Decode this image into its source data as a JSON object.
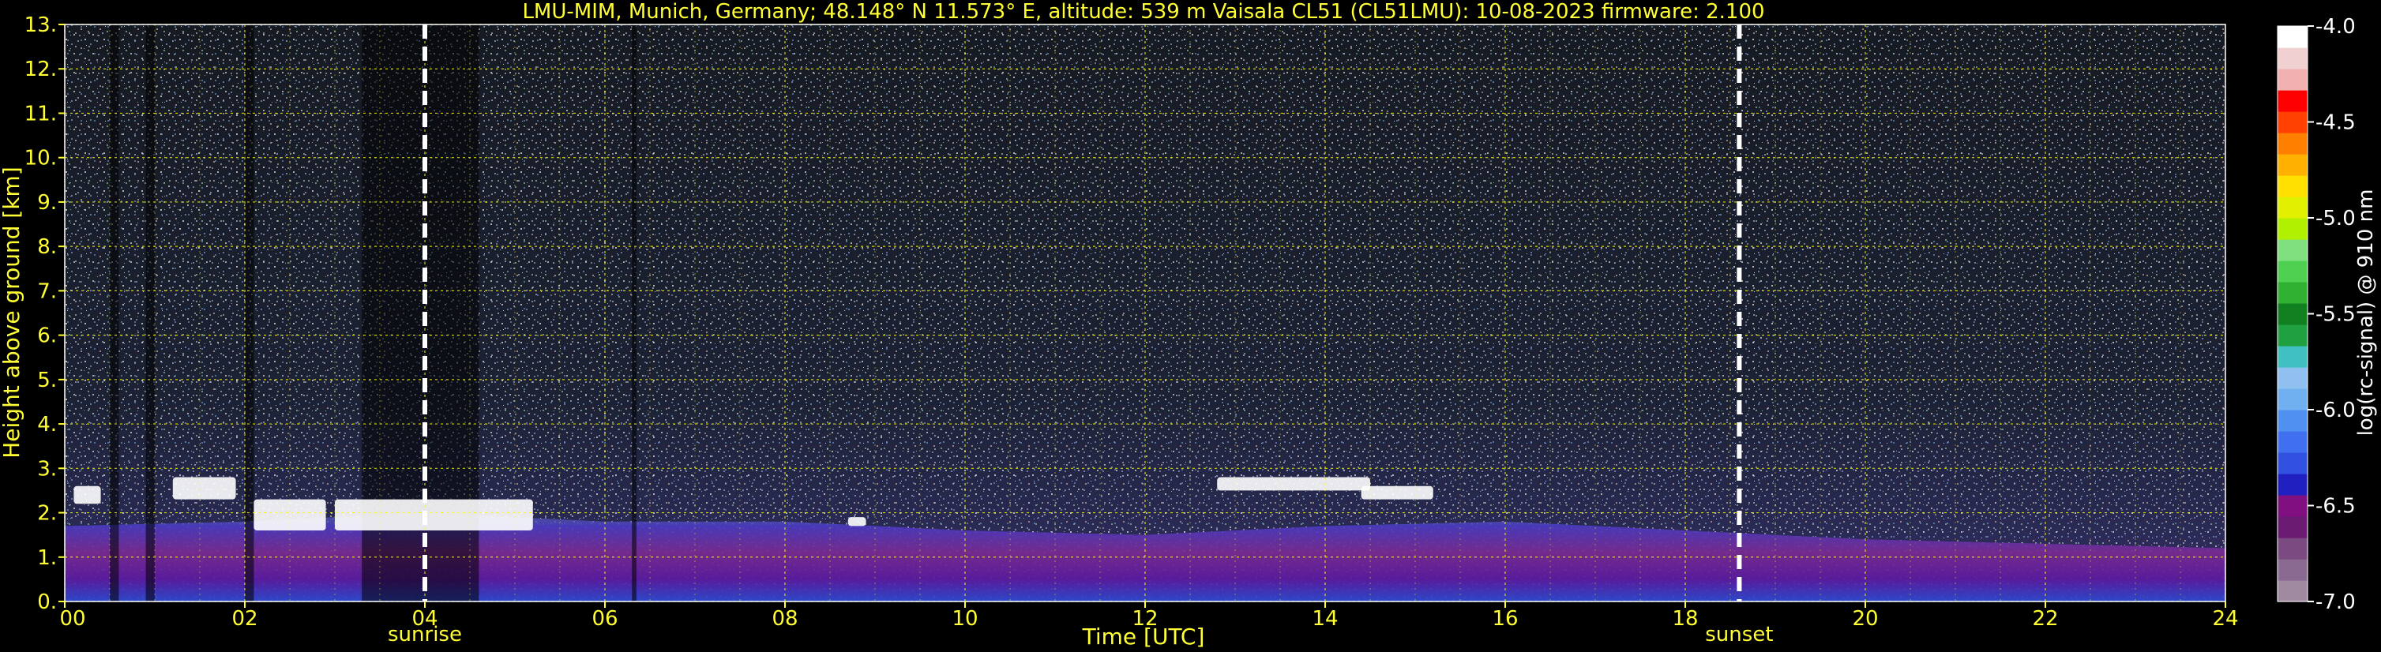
{
  "chart_data": {
    "type": "heatmap",
    "title": "LMU-MIM, Munich, Germany; 48.148° N 11.573° E, altitude: 539 m    Vaisala CL51 (CL51LMU): 10-08-2023    firmware: 2.100",
    "xlabel": "Time [UTC]",
    "ylabel": "Height above ground [km]",
    "xlim": [
      0,
      24
    ],
    "ylim": [
      0,
      13
    ],
    "x_ticks": [
      "00",
      "02",
      "04",
      "06",
      "08",
      "10",
      "12",
      "14",
      "16",
      "18",
      "20",
      "22",
      "24"
    ],
    "y_ticks": [
      "0.",
      "1.",
      "2.",
      "3.",
      "4.",
      "5.",
      "6.",
      "7.",
      "8.",
      "9.",
      "10.",
      "11.",
      "12.",
      "13."
    ],
    "grid": true,
    "grid_color": "#ffff00",
    "sunrise": {
      "time": 4.0,
      "label": "sunrise"
    },
    "sunset": {
      "time": 18.6,
      "label": "sunset"
    },
    "colorbar": {
      "label": "log(rc-signal) @ 910 nm",
      "range": [
        -7.0,
        -4.0
      ],
      "ticks": [
        "-4.0",
        "-4.5",
        "-5.0",
        "-5.5",
        "-6.0",
        "-6.5",
        "-7.0"
      ],
      "colors": [
        "#a08aa0",
        "#8a6a90",
        "#7a4a80",
        "#6a1a70",
        "#801080",
        "#2020c0",
        "#3050e0",
        "#4070f0",
        "#5090f0",
        "#70b0f0",
        "#90c0f0",
        "#40c0c0",
        "#20a040",
        "#108020",
        "#30b030",
        "#50d050",
        "#80e080",
        "#b0f000",
        "#e0f000",
        "#ffe000",
        "#ffb000",
        "#ff8000",
        "#ff4000",
        "#ff0000",
        "#f0b0b0",
        "#f0d0d0",
        "#ffffff"
      ]
    },
    "aerosol_layer": [
      {
        "t": 0.0,
        "top": 1.7
      },
      {
        "t": 2.0,
        "top": 1.8
      },
      {
        "t": 4.0,
        "top": 2.0
      },
      {
        "t": 6.0,
        "top": 1.8
      },
      {
        "t": 8.0,
        "top": 1.8
      },
      {
        "t": 10.0,
        "top": 1.6
      },
      {
        "t": 12.0,
        "top": 1.5
      },
      {
        "t": 14.0,
        "top": 1.7
      },
      {
        "t": 16.0,
        "top": 1.8
      },
      {
        "t": 18.0,
        "top": 1.6
      },
      {
        "t": 20.0,
        "top": 1.4
      },
      {
        "t": 22.0,
        "top": 1.3
      },
      {
        "t": 24.0,
        "top": 1.2
      }
    ],
    "cloud_layers": [
      {
        "start": 0.1,
        "end": 0.4,
        "base": 2.2,
        "top": 2.6
      },
      {
        "start": 1.2,
        "end": 1.9,
        "base": 2.3,
        "top": 2.8
      },
      {
        "start": 2.1,
        "end": 2.9,
        "base": 1.6,
        "top": 2.3
      },
      {
        "start": 3.0,
        "end": 5.2,
        "base": 1.6,
        "top": 2.3
      },
      {
        "start": 8.7,
        "end": 8.9,
        "base": 1.7,
        "top": 1.9
      },
      {
        "start": 12.8,
        "end": 14.5,
        "base": 2.5,
        "top": 2.8
      },
      {
        "start": 14.4,
        "end": 15.2,
        "base": 2.3,
        "top": 2.6
      }
    ]
  }
}
